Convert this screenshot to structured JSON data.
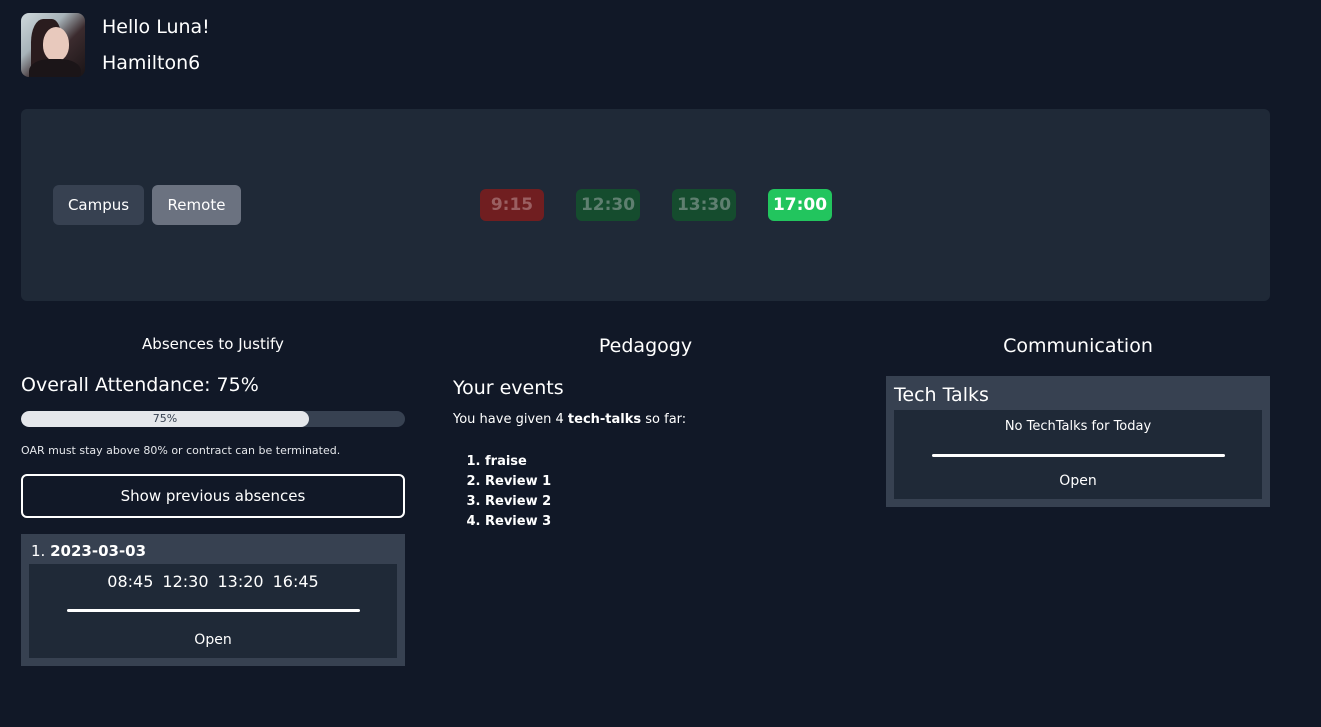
{
  "header": {
    "greeting": "Hello Luna!",
    "username": "Hamilton6"
  },
  "checkin": {
    "modes": [
      "Campus",
      "Remote"
    ],
    "slots": [
      "9:15",
      "12:30",
      "13:30",
      "17:00"
    ]
  },
  "absences": {
    "title": "Absences to Justify",
    "overall_label": "Overall Attendance: 75%",
    "progress_percent": 75,
    "progress_text": "75%",
    "note": "OAR must stay above 80% or contract can be terminated.",
    "show_previous_label": "Show previous absences",
    "items": [
      {
        "index": "1.",
        "date": "2023-03-03",
        "times": [
          "08:45",
          "12:30",
          "13:20",
          "16:45"
        ],
        "open_label": "Open"
      }
    ]
  },
  "pedagogy": {
    "title": "Pedagogy",
    "events_title": "Your events",
    "events_text_prefix": "You have given 4 ",
    "events_text_bold": "tech-talks",
    "events_text_suffix": " so far:",
    "events": [
      "fraise",
      "Review 1",
      "Review 2",
      "Review 3"
    ]
  },
  "communication": {
    "title": "Communication",
    "card_title": "Tech Talks",
    "message": "No TechTalks for Today",
    "open_label": "Open"
  },
  "colors": {
    "background": "#111827",
    "panel": "#1f2937",
    "card": "#374151",
    "slot_missed": "#7f1d1d",
    "slot_done": "#14532d",
    "slot_active": "#22c55e"
  },
  "icons": {
    "avatar": "user-avatar-photo"
  }
}
